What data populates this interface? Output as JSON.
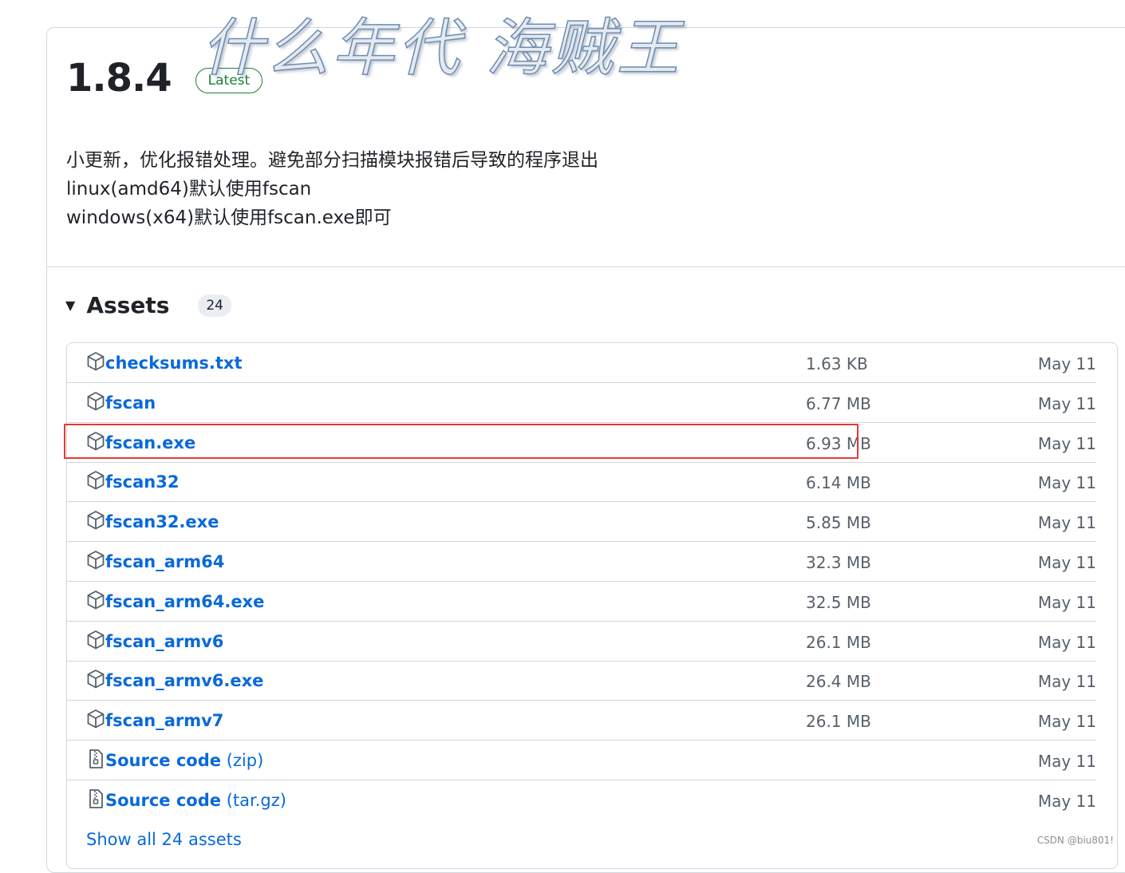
{
  "watermark": "什么年代 海贼王",
  "release": {
    "version": "1.8.4",
    "badge": "Latest",
    "notes": [
      "小更新，优化报错处理。避免部分扫描模块报错后导致的程序退出",
      "linux(amd64)默认使用fscan",
      "windows(x64)默认使用fscan.exe即可"
    ]
  },
  "assets": {
    "caret": "▼",
    "title": "Assets",
    "count": "24",
    "items": [
      {
        "name": "checksums.txt",
        "suffix": "",
        "size": "1.63 KB",
        "date": "May 11",
        "icon": "package-icon"
      },
      {
        "name": "fscan",
        "suffix": "",
        "size": "6.77 MB",
        "date": "May 11",
        "icon": "package-icon"
      },
      {
        "name": "fscan.exe",
        "suffix": "",
        "size": "6.93 MB",
        "date": "May 11",
        "icon": "package-icon"
      },
      {
        "name": "fscan32",
        "suffix": "",
        "size": "6.14 MB",
        "date": "May 11",
        "icon": "package-icon"
      },
      {
        "name": "fscan32.exe",
        "suffix": "",
        "size": "5.85 MB",
        "date": "May 11",
        "icon": "package-icon"
      },
      {
        "name": "fscan_arm64",
        "suffix": "",
        "size": "32.3 MB",
        "date": "May 11",
        "icon": "package-icon"
      },
      {
        "name": "fscan_arm64.exe",
        "suffix": "",
        "size": "32.5 MB",
        "date": "May 11",
        "icon": "package-icon"
      },
      {
        "name": "fscan_armv6",
        "suffix": "",
        "size": "26.1 MB",
        "date": "May 11",
        "icon": "package-icon"
      },
      {
        "name": "fscan_armv6.exe",
        "suffix": "",
        "size": "26.4 MB",
        "date": "May 11",
        "icon": "package-icon"
      },
      {
        "name": "fscan_armv7",
        "suffix": "",
        "size": "26.1 MB",
        "date": "May 11",
        "icon": "package-icon"
      },
      {
        "name": "Source code",
        "suffix": " (zip)",
        "size": "",
        "date": "May 11",
        "icon": "file-zip-icon"
      },
      {
        "name": "Source code",
        "suffix": " (tar.gz)",
        "size": "",
        "date": "May 11",
        "icon": "file-zip-icon"
      }
    ],
    "show_all": "Show all 24 assets",
    "highlighted_item": "fscan.exe"
  },
  "colors": {
    "link": "#0969da",
    "latest": "#1a7f37",
    "highlight": "#e53935",
    "muted": "#57606a"
  },
  "footer_credit": "CSDN @biu801!"
}
